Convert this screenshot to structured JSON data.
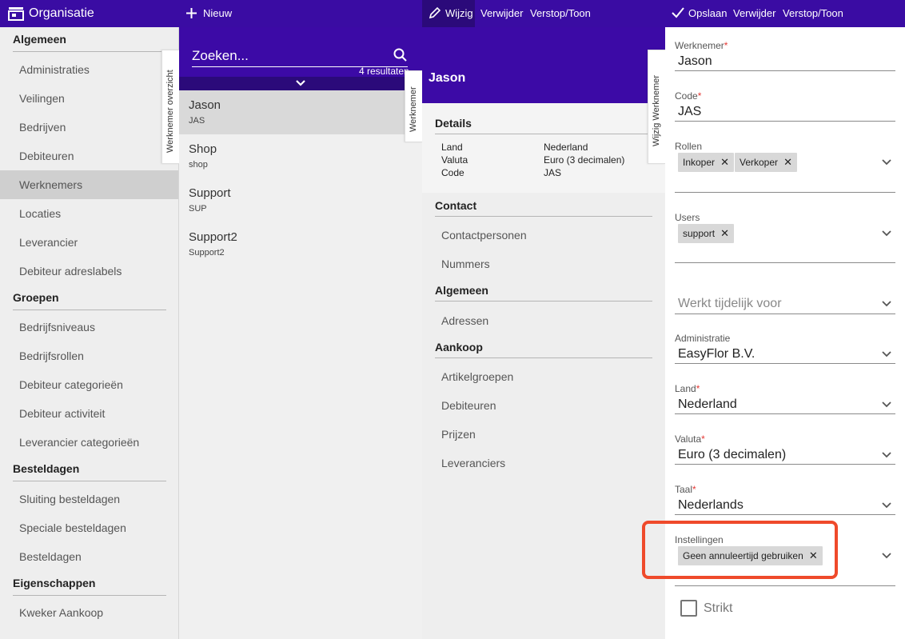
{
  "toolbar": {
    "app_title": "Organisatie",
    "new_label": "Nieuw",
    "edit_label": "Wijzig",
    "delete_label": "Verwijder",
    "hide_label": "Verstop/Toon",
    "save_label": "Opslaan",
    "delete2_label": "Verwijder",
    "hide2_label": "Verstop/Toon"
  },
  "nav": {
    "groups": [
      {
        "title": "Algemeen",
        "items": [
          "Administraties",
          "Veilingen",
          "Bedrijven",
          "Debiteuren",
          "Werknemers",
          "Locaties",
          "Leverancier",
          "Debiteur adreslabels"
        ]
      },
      {
        "title": "Groepen",
        "items": [
          "Bedrijfsniveaus",
          "Bedrijfsrollen",
          "Debiteur categorieën",
          "Debiteur activiteit",
          "Leverancier categorieën"
        ]
      },
      {
        "title": "Besteldagen",
        "items": [
          "Sluiting besteldagen",
          "Speciale besteldagen",
          "Besteldagen"
        ]
      },
      {
        "title": "Eigenschappen",
        "items": [
          "Kweker Aankoop"
        ]
      }
    ],
    "active": "Werknemers"
  },
  "search": {
    "placeholder": "Zoeken...",
    "results": "4 resultaten"
  },
  "list": {
    "items": [
      {
        "name": "Jason",
        "code": "JAS"
      },
      {
        "name": "Shop",
        "code": "shop"
      },
      {
        "name": "Support",
        "code": "SUP"
      },
      {
        "name": "Support2",
        "code": "Support2"
      }
    ]
  },
  "tabs": {
    "overview": "Werknemer overzicht",
    "employee": "Werknemer",
    "edit": "Wijzig Werknemer"
  },
  "details": {
    "title": "Jason",
    "details_header": "Details",
    "rows": [
      {
        "key": "Land",
        "value": "Nederland"
      },
      {
        "key": "Valuta",
        "value": "Euro (3 decimalen)"
      },
      {
        "key": "Code",
        "value": "JAS"
      }
    ],
    "contact_header": "Contact",
    "contact_links": [
      "Contactpersonen",
      "Nummers"
    ],
    "general_header": "Algemeen",
    "general_links": [
      "Adressen"
    ],
    "purchase_header": "Aankoop",
    "purchase_links": [
      "Artikelgroepen",
      "Debiteuren",
      "Prijzen",
      "Leveranciers"
    ]
  },
  "form": {
    "employee_label": "Werknemer",
    "employee_value": "Jason",
    "code_label": "Code",
    "code_value": "JAS",
    "roles_label": "Rollen",
    "roles": [
      "Inkoper",
      "Verkoper"
    ],
    "users_label": "Users",
    "users": [
      "support"
    ],
    "temp_placeholder": "Werkt tijdelijk voor",
    "admin_label": "Administratie",
    "admin_value": "EasyFlor B.V.",
    "country_label": "Land",
    "country_value": "Nederland",
    "currency_label": "Valuta",
    "currency_value": "Euro (3 decimalen)",
    "language_label": "Taal",
    "language_value": "Nederlands",
    "settings_label": "Instellingen",
    "settings": [
      "Geen annuleertijd gebruiken"
    ],
    "strict_label": "Strikt",
    "required_mark": "*",
    "chip_remove": "✕"
  },
  "colors": {
    "toolbar": "#3a0ca3",
    "detail_header": "#3c0aa6",
    "required": "#e53935",
    "highlight": "#ef4a2b"
  }
}
